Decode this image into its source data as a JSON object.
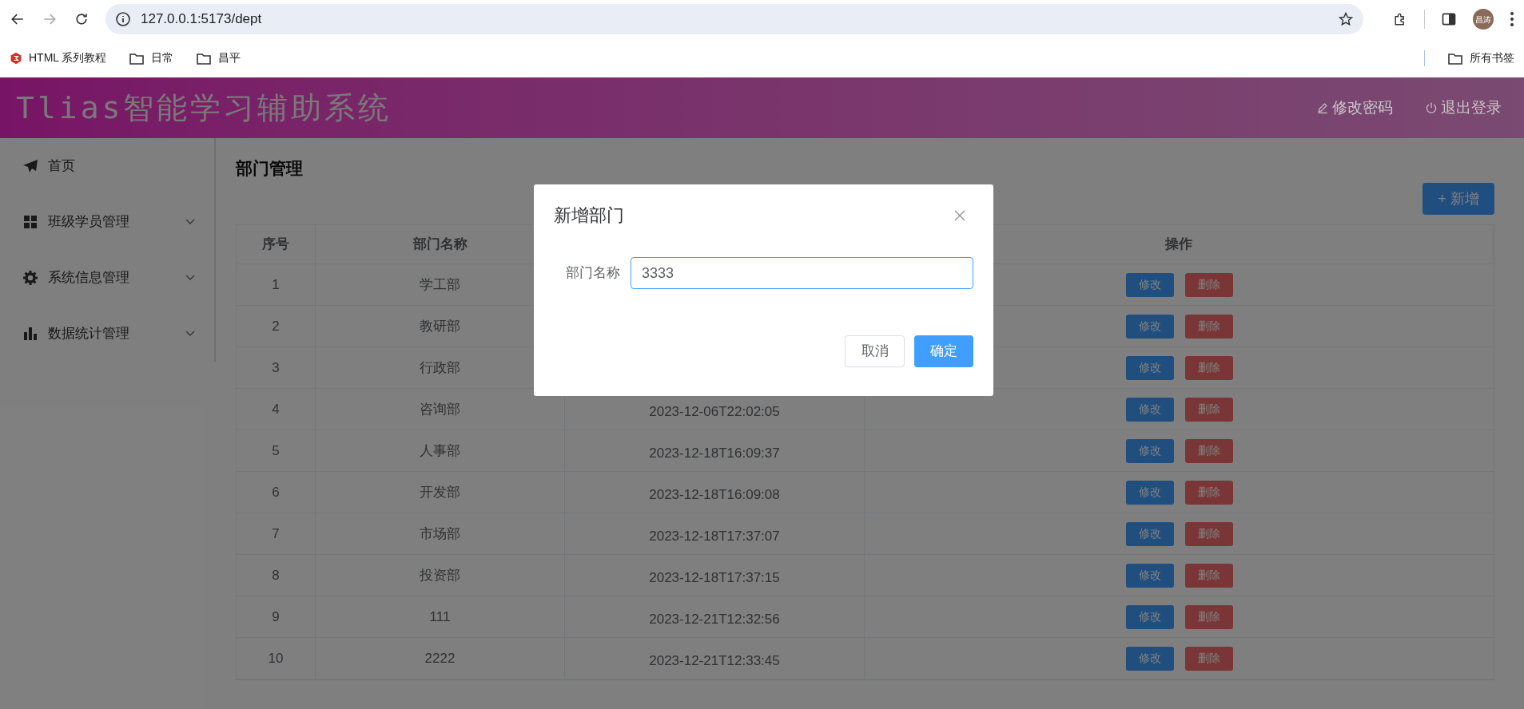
{
  "browser": {
    "url": "127.0.0.1:5173/dept",
    "profile": "昌涛",
    "bookmarks": [
      {
        "kind": "site",
        "label": "HTML 系列教程"
      },
      {
        "kind": "folder",
        "label": "日常"
      },
      {
        "kind": "folder",
        "label": "昌平"
      }
    ],
    "all_bookmarks": "所有书签"
  },
  "header": {
    "title": "Tlias智能学习辅助系统",
    "actions": [
      {
        "kind": "password",
        "label": "修改密码"
      },
      {
        "kind": "logout",
        "label": "退出登录"
      }
    ]
  },
  "sidebar": {
    "items": [
      {
        "kind": "home",
        "label": "首页",
        "has_submenu": false
      },
      {
        "kind": "classes",
        "label": "班级学员管理",
        "has_submenu": true
      },
      {
        "kind": "system",
        "label": "系统信息管理",
        "has_submenu": true
      },
      {
        "kind": "statistics",
        "label": "数据统计管理",
        "has_submenu": true
      }
    ]
  },
  "page": {
    "title": "部门管理",
    "add_button": "+ 新增"
  },
  "table": {
    "headers": {
      "index": "序号",
      "name": "部门名称",
      "actions": "操作"
    },
    "rows": [
      {
        "index": "1",
        "name": "学工部",
        "edit": "修改",
        "delete": "删除"
      },
      {
        "index": "2",
        "name": "教研部",
        "edit": "修改",
        "delete": "删除"
      },
      {
        "index": "3",
        "name": "行政部",
        "edit": "修改",
        "delete": "删除"
      },
      {
        "index": "4",
        "name": "咨询部",
        "column_3": "2023-12-06T22:02:05",
        "edit": "修改",
        "delete": "删除"
      },
      {
        "index": "5",
        "name": "人事部",
        "column_3": "2023-12-18T16:09:37",
        "edit": "修改",
        "delete": "删除"
      },
      {
        "index": "6",
        "name": "开发部",
        "column_3": "2023-12-18T16:09:08",
        "edit": "修改",
        "delete": "删除"
      },
      {
        "index": "7",
        "name": "市场部",
        "column_3": "2023-12-18T17:37:07",
        "edit": "修改",
        "delete": "删除"
      },
      {
        "index": "8",
        "name": "投资部",
        "column_3": "2023-12-18T17:37:15",
        "edit": "修改",
        "delete": "删除"
      },
      {
        "index": "9",
        "name": "111",
        "column_3": "2023-12-21T12:32:56",
        "edit": "修改",
        "delete": "删除"
      },
      {
        "index": "10",
        "name": "2222",
        "column_3": "2023-12-21T12:33:45",
        "edit": "修改",
        "delete": "删除"
      }
    ]
  },
  "dialog": {
    "title": "新增部门",
    "field_label": "部门名称",
    "field_value": "3333",
    "cancel": "取消",
    "confirm": "确定"
  }
}
